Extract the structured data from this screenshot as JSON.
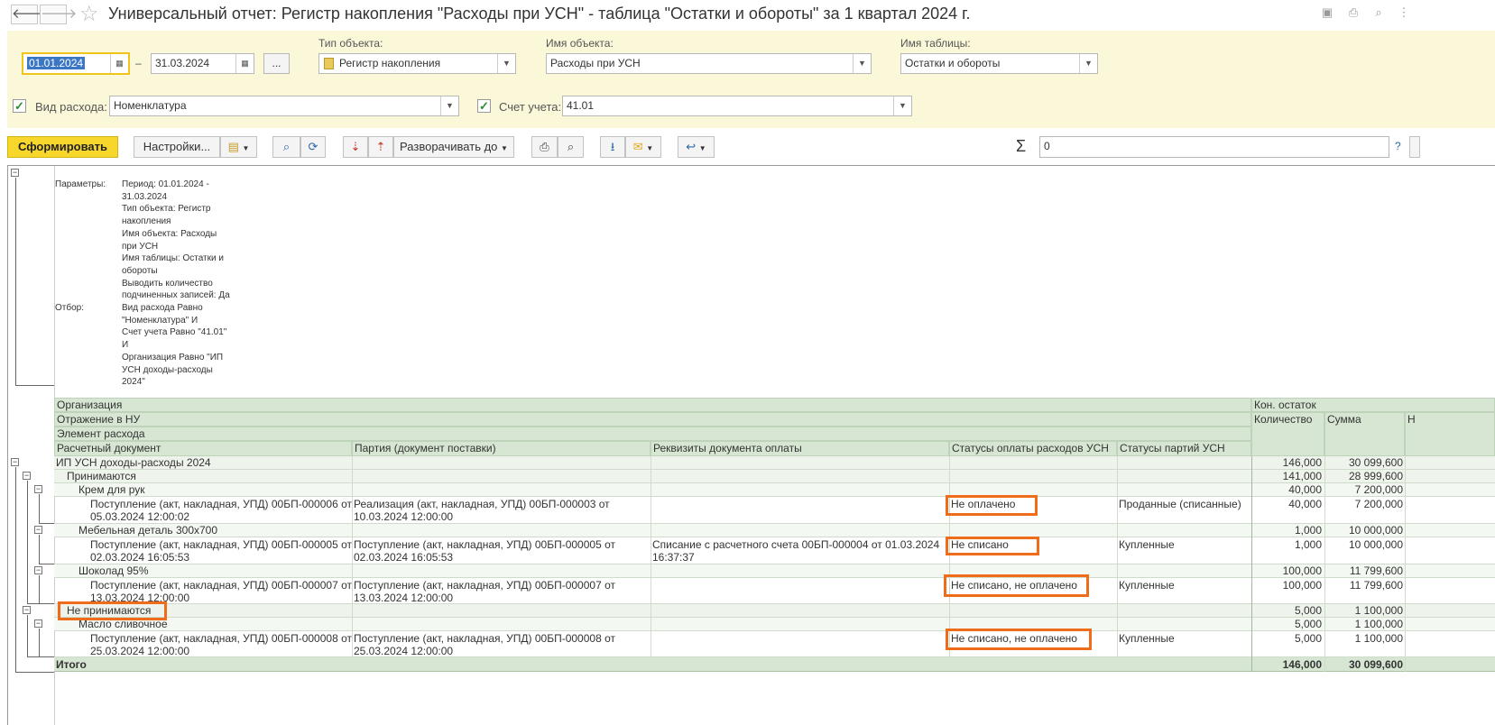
{
  "window": {
    "title": "Универсальный отчет: Регистр накопления \"Расходы при УСН\" - таблица \"Остатки и обороты\" за 1 квартал 2024 г.",
    "back_icon": "arrow-left-icon",
    "forward_icon": "arrow-right-icon",
    "favorite_icon": "star-icon"
  },
  "params": {
    "date_from": "01.01.2024",
    "dash": "–",
    "date_to": "31.03.2024",
    "period_button": "...",
    "object_type_label": "Тип объекта:",
    "object_type_value": "Регистр накопления",
    "object_name_label": "Имя объекта:",
    "object_name_value": "Расходы при УСН",
    "table_name_label": "Имя таблицы:",
    "table_name_value": "Остатки и обороты",
    "expense_kind_label": "Вид расхода:",
    "expense_kind_value": "Номенклатура",
    "account_label": "Счет учета:",
    "account_value": "41.01"
  },
  "toolbar": {
    "generate": "Сформировать",
    "settings": "Настройки...",
    "expand": "Разворачивать до",
    "sum_symbol": "Σ",
    "sum_value": "0",
    "help": "?"
  },
  "report_params": {
    "params_label": "Параметры:",
    "params_lines": [
      "Период: 01.01.2024 -",
      "31.03.2024",
      "Тип объекта: Регистр",
      "накопления",
      "Имя объекта: Расходы",
      "при УСН",
      "Имя таблицы: Остатки и",
      "обороты",
      "Выводить количество",
      "подчиненных записей: Да"
    ],
    "filter_label": "Отбор:",
    "filter_lines": [
      "Вид расхода Равно",
      "\"Номенклатура\" И",
      "Счет учета Равно \"41.01\"",
      "И",
      "Организация Равно \"ИП",
      "УСН доходы-расходы",
      "2024\""
    ]
  },
  "table": {
    "headers": {
      "org": "Организация",
      "nu": "Отражение в НУ",
      "element": "Элемент расхода",
      "doc": "Расчетный документ",
      "batch": "Партия (документ поставки)",
      "payment": "Реквизиты документа оплаты",
      "pay_status": "Статусы оплаты расходов УСН",
      "batch_status": "Статусы партий УСН",
      "end_balance": "Кон. остаток",
      "qty": "Количество",
      "sum": "Сумма",
      "next": "Н"
    },
    "org_row": {
      "name": "ИП УСН доходы-расходы 2024",
      "qty": "146,000",
      "sum": "30 099,600"
    },
    "accepted": {
      "name": "Принимаются",
      "qty": "141,000",
      "sum": "28 999,600"
    },
    "cream": {
      "name": "Крем для рук",
      "qty": "40,000",
      "sum": "7 200,000"
    },
    "cream_doc": {
      "doc1": "Поступление (акт, накладная, УПД) 00БП-000006 от",
      "doc2": "05.03.2024 12:00:02",
      "batch1": "Реализация (акт, накладная, УПД) 00БП-000003 от",
      "batch2": "10.03.2024 12:00:00",
      "pay1": "",
      "pay2": "",
      "pay_status": "Не оплачено",
      "batch_status": "Проданные (списанные)",
      "qty": "40,000",
      "sum": "7 200,000"
    },
    "furniture": {
      "name": "Мебельная деталь 300х700",
      "qty": "1,000",
      "sum": "10 000,000"
    },
    "furniture_doc": {
      "doc1": "Поступление (акт, накладная, УПД) 00БП-000005 от",
      "doc2": "02.03.2024 16:05:53",
      "batch1": "Поступление (акт, накладная, УПД) 00БП-000005 от",
      "batch2": "02.03.2024 16:05:53",
      "pay1": "Списание с расчетного счета 00БП-000004 от 01.03.2024",
      "pay2": "16:37:37",
      "pay_status": "Не списано",
      "batch_status": "Купленные",
      "qty": "1,000",
      "sum": "10 000,000"
    },
    "chocolate": {
      "name": "Шоколад 95%",
      "qty": "100,000",
      "sum": "11 799,600"
    },
    "chocolate_doc": {
      "doc1": "Поступление (акт, накладная, УПД) 00БП-000007 от",
      "doc2": "13.03.2024 12:00:00",
      "batch1": "Поступление (акт, накладная, УПД) 00БП-000007 от",
      "batch2": "13.03.2024 12:00:00",
      "pay1": "",
      "pay2": "",
      "pay_status": "Не списано, не оплачено",
      "batch_status": "Купленные",
      "qty": "100,000",
      "sum": "11 799,600"
    },
    "not_accepted": {
      "name": "Не принимаются",
      "qty": "5,000",
      "sum": "1 100,000"
    },
    "butter": {
      "name": "Масло сливочное",
      "qty": "5,000",
      "sum": "1 100,000"
    },
    "butter_doc": {
      "doc1": "Поступление (акт, накладная, УПД) 00БП-000008 от",
      "doc2": "25.03.2024 12:00:00",
      "batch1": "Поступление (акт, накладная, УПД) 00БП-000008 от",
      "batch2": "25.03.2024 12:00:00",
      "pay1": "",
      "pay2": "",
      "pay_status": "Не списано, не оплачено",
      "batch_status": "Купленные",
      "qty": "5,000",
      "sum": "1 100,000"
    },
    "total": {
      "name": "Итого",
      "qty": "146,000",
      "sum": "30 099,600"
    }
  },
  "colors": {
    "panel_bg": "#fbf8d9",
    "primary_button": "#f7d72b",
    "header_bg": "#d6e6d2",
    "highlight": "#ef6c1a"
  }
}
